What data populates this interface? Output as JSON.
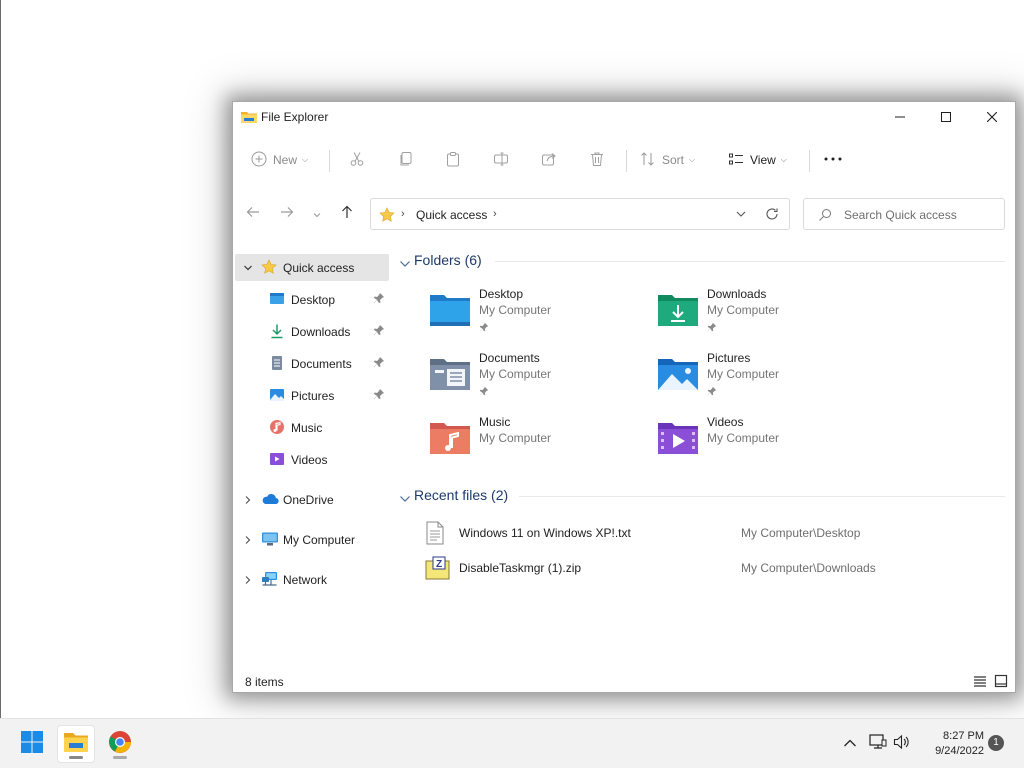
{
  "window": {
    "title": "File Explorer"
  },
  "toolbar": {
    "new_label": "New",
    "sort_label": "Sort",
    "view_label": "View"
  },
  "address": {
    "crumb": "Quick access"
  },
  "search": {
    "placeholder": "Search Quick access"
  },
  "sidebar": {
    "items": [
      {
        "label": "Quick access"
      },
      {
        "label": "Desktop"
      },
      {
        "label": "Downloads"
      },
      {
        "label": "Documents"
      },
      {
        "label": "Pictures"
      },
      {
        "label": "Music"
      },
      {
        "label": "Videos"
      },
      {
        "label": "OneDrive"
      },
      {
        "label": "My Computer"
      },
      {
        "label": "Network"
      }
    ]
  },
  "folders": {
    "heading": "Folders (6)",
    "items": [
      {
        "name": "Desktop",
        "location": "My Computer"
      },
      {
        "name": "Downloads",
        "location": "My Computer"
      },
      {
        "name": "Documents",
        "location": "My Computer"
      },
      {
        "name": "Pictures",
        "location": "My Computer"
      },
      {
        "name": "Music",
        "location": "My Computer"
      },
      {
        "name": "Videos",
        "location": "My Computer"
      }
    ]
  },
  "recent": {
    "heading": "Recent files (2)",
    "items": [
      {
        "name": "Windows 11 on Windows XP!.txt",
        "location": "My Computer\\Desktop"
      },
      {
        "name": "DisableTaskmgr (1).zip",
        "location": "My Computer\\Downloads"
      }
    ]
  },
  "status": {
    "items_count": "8 items"
  },
  "taskbar": {
    "time": "8:27 PM",
    "date": "9/24/2022",
    "notification_count": "1"
  },
  "colors": {
    "accent": "#0078d4",
    "folder_yellow": "#f7c948",
    "section_heading": "#1c3a6b"
  }
}
